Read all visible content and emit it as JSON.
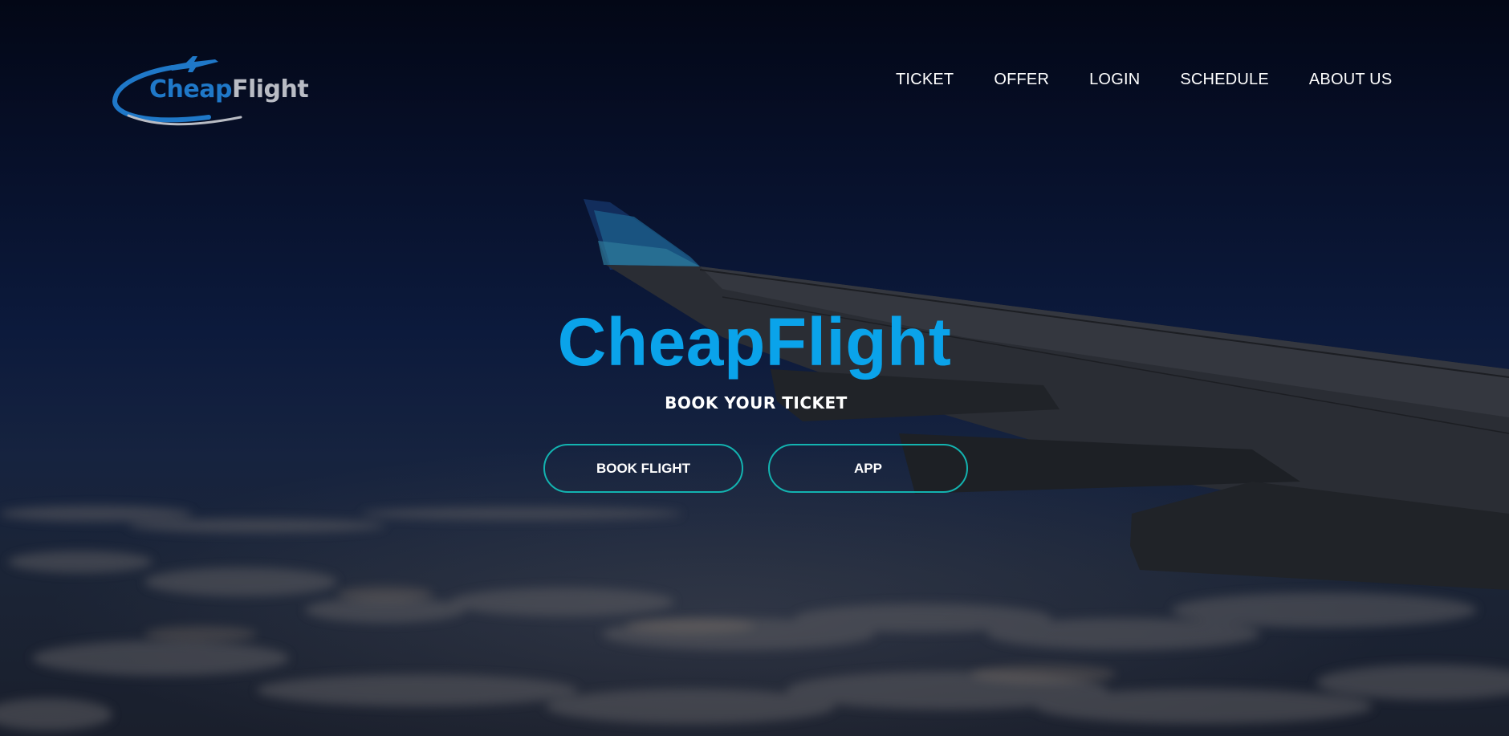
{
  "brand": {
    "logo_part1": "Cheap",
    "logo_part2": "Flight",
    "logo_icon": "airplane-icon",
    "primary_color": "#0aa3ea",
    "logo_blue": "#1f78c8",
    "logo_gray": "#b9bcc4"
  },
  "nav": {
    "items": [
      {
        "label": "TICKET"
      },
      {
        "label": "OFFER"
      },
      {
        "label": "LOGIN"
      },
      {
        "label": "SCHEDULE"
      },
      {
        "label": "ABOUT US"
      }
    ]
  },
  "hero": {
    "title": "CheapFlight",
    "subtitle": "BOOK YOUR TICKET",
    "button_accent": "#13b3b0",
    "buttons": [
      {
        "label": "BOOK FLIGHT"
      },
      {
        "label": "APP"
      }
    ]
  }
}
